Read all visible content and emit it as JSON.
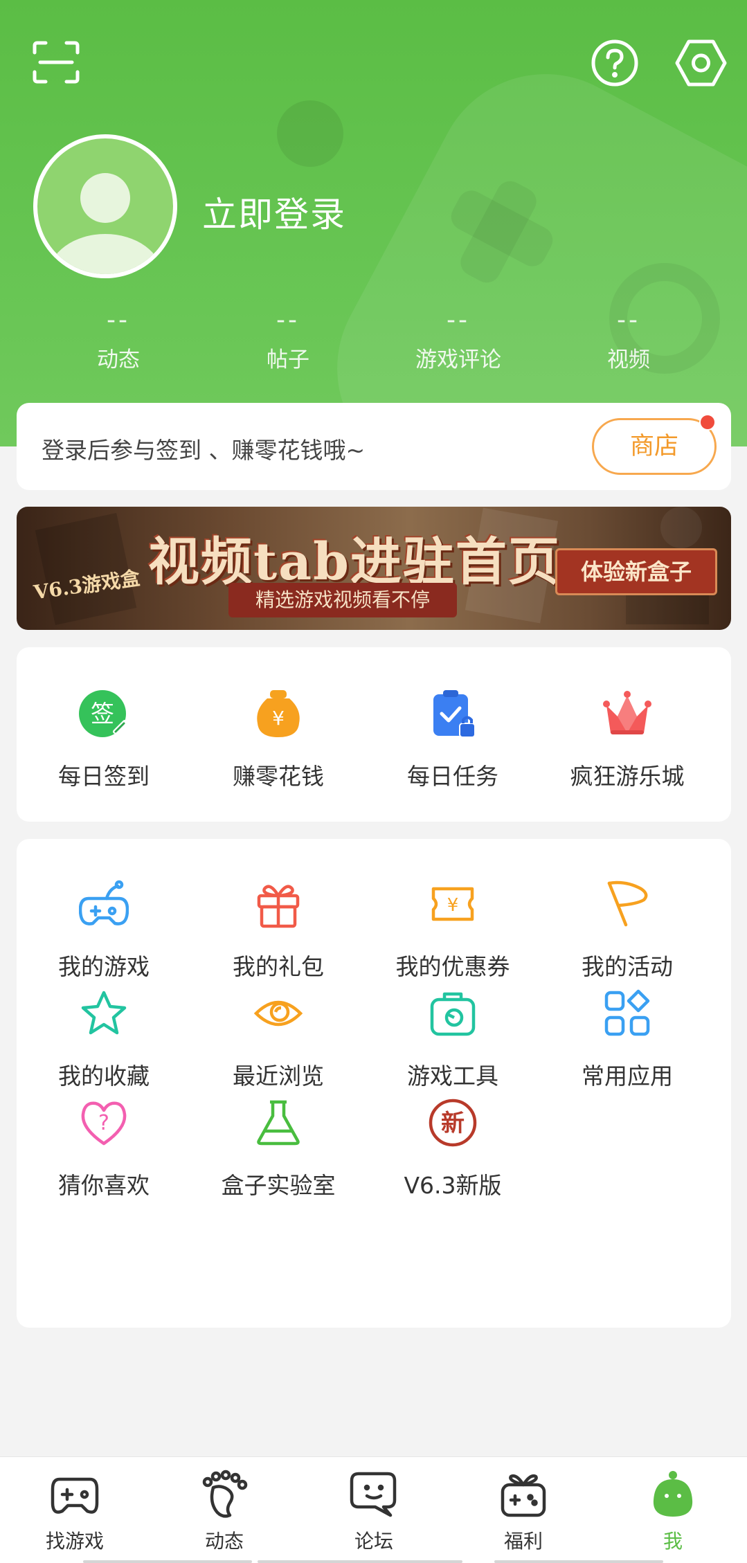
{
  "header": {
    "login_label": "立即登录",
    "stats": [
      {
        "value": "--",
        "label": "动态"
      },
      {
        "value": "--",
        "label": "帖子"
      },
      {
        "value": "--",
        "label": "游戏评论"
      },
      {
        "value": "--",
        "label": "视频"
      }
    ]
  },
  "promo": {
    "text": "登录后参与签到 、赚零花钱哦~",
    "shop_label": "商店"
  },
  "banner": {
    "badge": "V6.3游戏盒",
    "title": "视频tab进驻首页",
    "subtitle": "精选游戏视频看不停",
    "cta": "体验新盒子"
  },
  "quick_actions": [
    {
      "label": "每日签到",
      "icon": "sign-in-icon",
      "glyph": "签"
    },
    {
      "label": "赚零花钱",
      "icon": "money-bag-icon",
      "glyph": "¥"
    },
    {
      "label": "每日任务",
      "icon": "task-clipboard-icon"
    },
    {
      "label": "疯狂游乐城",
      "icon": "crown-icon"
    }
  ],
  "menu": [
    {
      "label": "我的游戏",
      "icon": "gamepad-icon"
    },
    {
      "label": "我的礼包",
      "icon": "gift-icon"
    },
    {
      "label": "我的优惠券",
      "icon": "coupon-icon",
      "glyph": "¥"
    },
    {
      "label": "我的活动",
      "icon": "flag-icon"
    },
    {
      "label": "我的收藏",
      "icon": "star-icon"
    },
    {
      "label": "最近浏览",
      "icon": "eye-icon"
    },
    {
      "label": "游戏工具",
      "icon": "toolbox-icon"
    },
    {
      "label": "常用应用",
      "icon": "apps-grid-icon"
    },
    {
      "label": "猜你喜欢",
      "icon": "heart-question-icon",
      "glyph": "?"
    },
    {
      "label": "盒子实验室",
      "icon": "flask-icon"
    },
    {
      "label": "V6.3新版",
      "icon": "new-version-icon",
      "glyph": "新"
    }
  ],
  "tabbar": [
    {
      "label": "找游戏",
      "icon": "controller-icon"
    },
    {
      "label": "动态",
      "icon": "footprint-icon"
    },
    {
      "label": "论坛",
      "icon": "chat-bubble-icon"
    },
    {
      "label": "福利",
      "icon": "gift-gamepad-icon"
    },
    {
      "label": "我",
      "icon": "profile-icon",
      "active": true
    }
  ],
  "colors": {
    "header_green": "#5bbd45",
    "accent_orange": "#f39a2b",
    "badge_red": "#f04b3c"
  }
}
